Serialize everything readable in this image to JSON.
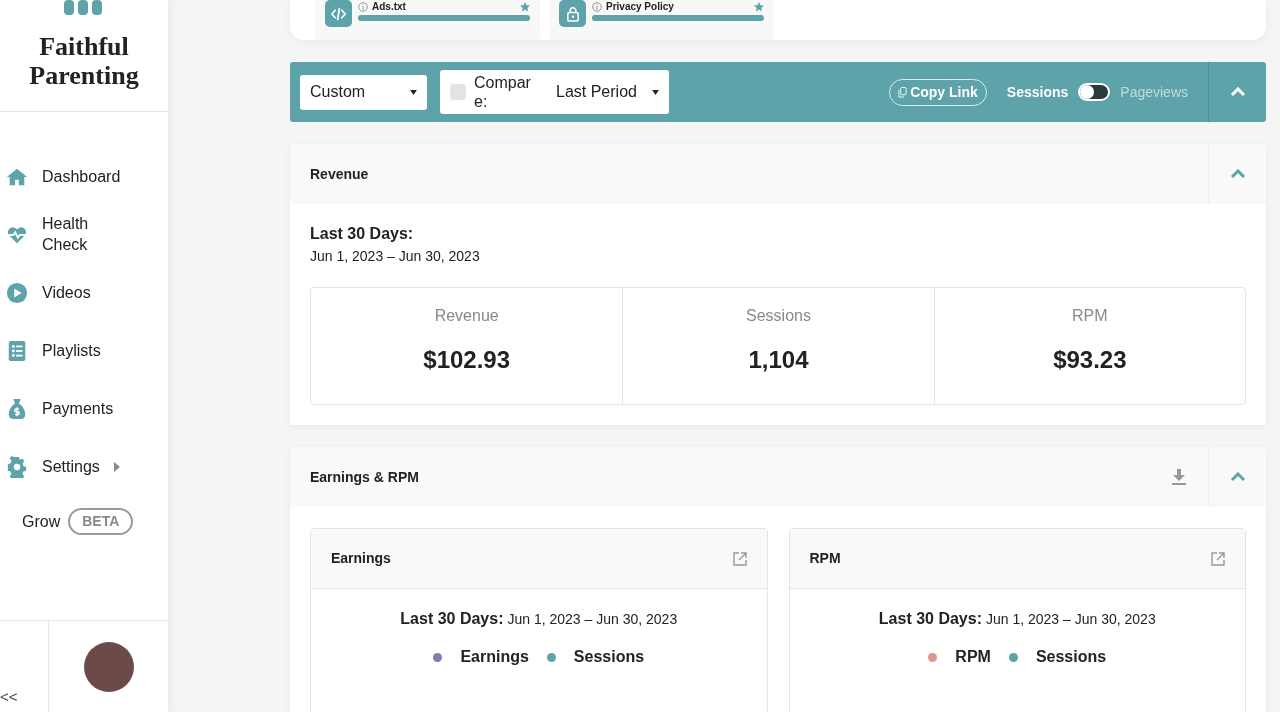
{
  "sidebar": {
    "brand": "Faithful Parenting",
    "nav": [
      {
        "label": "Dashboard",
        "has_submenu": false
      },
      {
        "label": "Health Check",
        "has_submenu": false
      },
      {
        "label": "Videos",
        "has_submenu": false
      },
      {
        "label": "Playlists",
        "has_submenu": false
      },
      {
        "label": "Payments",
        "has_submenu": false
      },
      {
        "label": "Settings",
        "has_submenu": true
      }
    ],
    "grow": {
      "label": "Grow",
      "badge": "BETA"
    },
    "collapse": "<<"
  },
  "tiles": [
    {
      "title": "Ads.txt",
      "level": 1
    },
    {
      "title": "Privacy Policy",
      "level": 1
    }
  ],
  "filter_bar": {
    "range": "Custom",
    "compare": {
      "checked": false,
      "label": "Compare:",
      "value": "Last Period"
    },
    "copy_link": "Copy Link",
    "metric_toggle": {
      "left": "Sessions",
      "right": "Pageviews",
      "on": false
    }
  },
  "revenue": {
    "title": "Revenue",
    "period_label": "Last 30 Days:",
    "period": "Jun 1, 2023 – Jun 30, 2023",
    "stats": [
      {
        "label": "Revenue",
        "value": "$102.93"
      },
      {
        "label": "Sessions",
        "value": "1,104"
      },
      {
        "label": "RPM",
        "value": "$93.23"
      }
    ]
  },
  "earnings": {
    "title": "Earnings & RPM",
    "charts": [
      {
        "title": "Earnings",
        "period_label": "Last 30 Days:",
        "period": "Jun 1, 2023 – Jun 30, 2023",
        "legend": [
          {
            "name": "Earnings",
            "color": "#857ba6"
          },
          {
            "name": "Sessions",
            "color": "#5ea3a9"
          }
        ]
      },
      {
        "title": "RPM",
        "period_label": "Last 30 Days:",
        "period": "Jun 1, 2023 – Jun 30, 2023",
        "legend": [
          {
            "name": "RPM",
            "color": "#df958e"
          },
          {
            "name": "Sessions",
            "color": "#5ea3a9"
          }
        ]
      }
    ]
  }
}
